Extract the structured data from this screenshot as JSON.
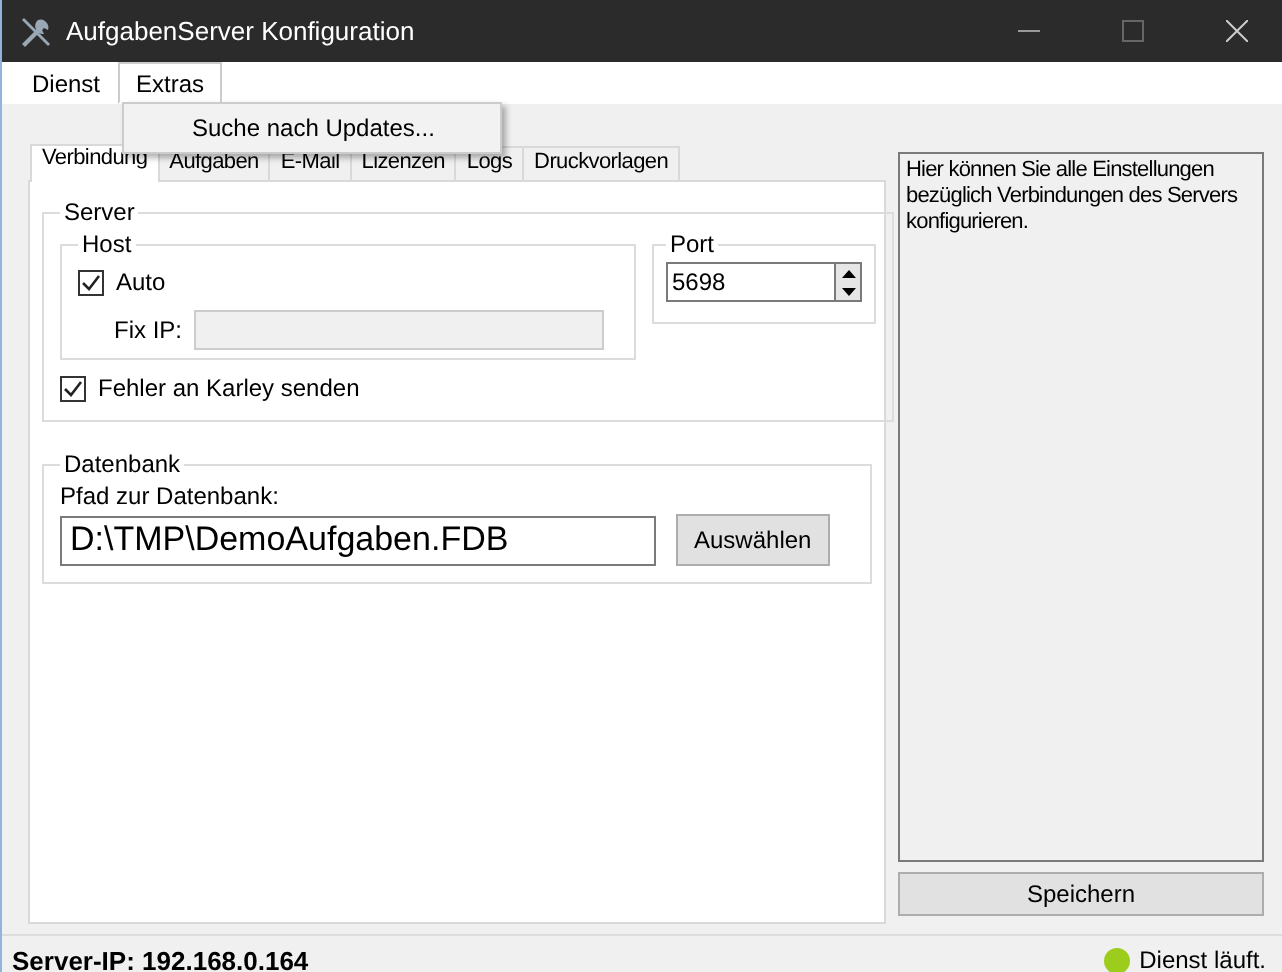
{
  "window": {
    "title": "AufgabenServer Konfiguration"
  },
  "menu": [
    {
      "label": "Dienst",
      "expanded": false
    },
    {
      "label": "Extras",
      "expanded": true,
      "items": [
        "Suche nach Updates..."
      ]
    }
  ],
  "tabs": [
    {
      "label": "Verbindung",
      "selected": true
    },
    {
      "label": "Aufgaben",
      "selected": false
    },
    {
      "label": "E-Mail",
      "selected": false
    },
    {
      "label": "Lizenzen",
      "selected": false
    },
    {
      "label": "Logs",
      "selected": false
    },
    {
      "label": "Druckvorlagen",
      "selected": false
    }
  ],
  "server": {
    "title": "Server",
    "host": {
      "title": "Host",
      "auto_label": "Auto",
      "auto_checked": true,
      "fix_ip_label": "Fix IP:",
      "fix_ip_disabled": true
    },
    "port": {
      "title": "Port",
      "value": "5698"
    },
    "send_errors": {
      "label": "Fehler an Karley senden",
      "checked": true
    }
  },
  "database": {
    "title": "Datenbank",
    "path_label": "Pfad zur Datenbank:",
    "path": "D:\\TMP\\DemoAufgaben.FDB",
    "button": "Auswählen"
  },
  "help_text": "Hier können Sie alle Einstellungen bezüglich Verbindungen des Servers konfigurieren.",
  "save_button": "Speichern",
  "status_bar": {
    "server_ip": "Server-IP: 192.168.0.164",
    "status": {
      "text": "Dienst läuft.",
      "color": "#9ccc1c"
    }
  }
}
